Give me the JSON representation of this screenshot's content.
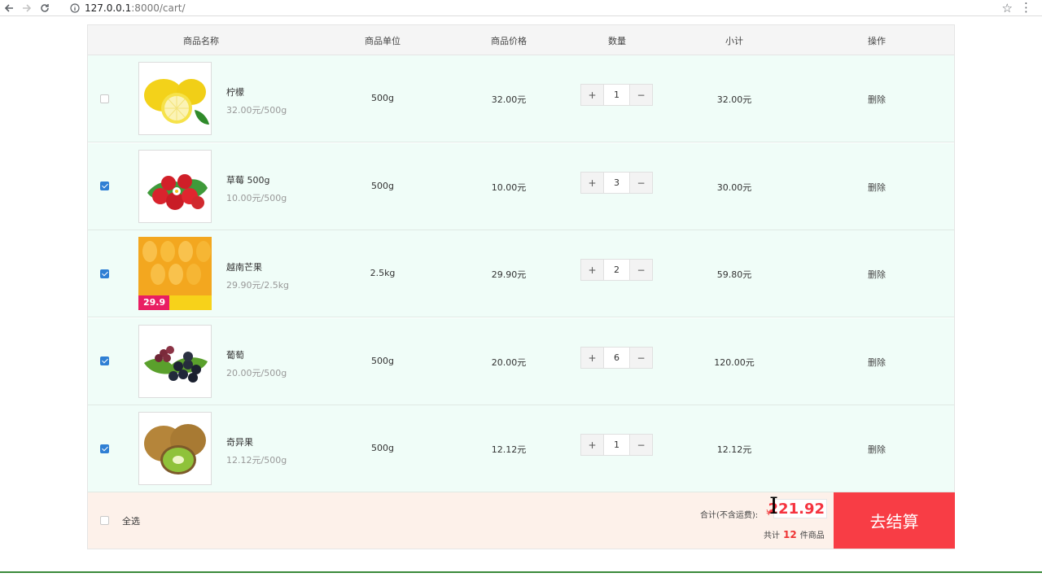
{
  "browser": {
    "url_host": "127.0.0.1",
    "url_path": ":8000/cart/",
    "back_icon": "arrow-left-icon",
    "forward_icon": "arrow-right-icon",
    "reload_icon": "reload-icon"
  },
  "table": {
    "headers": {
      "name": "商品名称",
      "unit": "商品单位",
      "price": "商品价格",
      "qty": "数量",
      "subtotal": "小计",
      "action": "操作"
    }
  },
  "items": [
    {
      "name": "柠檬",
      "unit_price": "32.00元/500g",
      "unit": "500g",
      "price": "32.00元",
      "qty": "1",
      "subtotal": "32.00元",
      "delete": "删除",
      "checked": false,
      "image": "lemon"
    },
    {
      "name": "草莓 500g",
      "unit_price": "10.00元/500g",
      "unit": "500g",
      "price": "10.00元",
      "qty": "3",
      "subtotal": "30.00元",
      "delete": "删除",
      "checked": true,
      "image": "strawberry"
    },
    {
      "name": "越南芒果",
      "unit_price": "29.90元/2.5kg",
      "unit": "2.5kg",
      "price": "29.90元",
      "qty": "2",
      "subtotal": "59.80元",
      "delete": "删除",
      "checked": true,
      "image": "mango",
      "image_text": "29.9"
    },
    {
      "name": "葡萄",
      "unit_price": "20.00元/500g",
      "unit": "500g",
      "price": "20.00元",
      "qty": "6",
      "subtotal": "120.00元",
      "delete": "删除",
      "checked": true,
      "image": "grape"
    },
    {
      "name": "奇异果",
      "unit_price": "12.12元/500g",
      "unit": "500g",
      "price": "12.12元",
      "qty": "1",
      "subtotal": "12.12元",
      "delete": "删除",
      "checked": true,
      "image": "kiwi"
    }
  ],
  "qty_controls": {
    "plus": "+",
    "minus": "−"
  },
  "footer": {
    "select_all": "全选",
    "select_all_checked": false,
    "total_label": "合计(不含运费):",
    "currency": "¥",
    "total": "221.92",
    "count_prefix": "共计",
    "count": "12",
    "count_suffix": "件商品",
    "checkout": "去结算"
  },
  "colors": {
    "row_bg": "#f0fdf8",
    "footer_bg": "#fdf1ea",
    "accent_red": "#f83d45",
    "checkbox_blue": "#2f7fd4"
  }
}
